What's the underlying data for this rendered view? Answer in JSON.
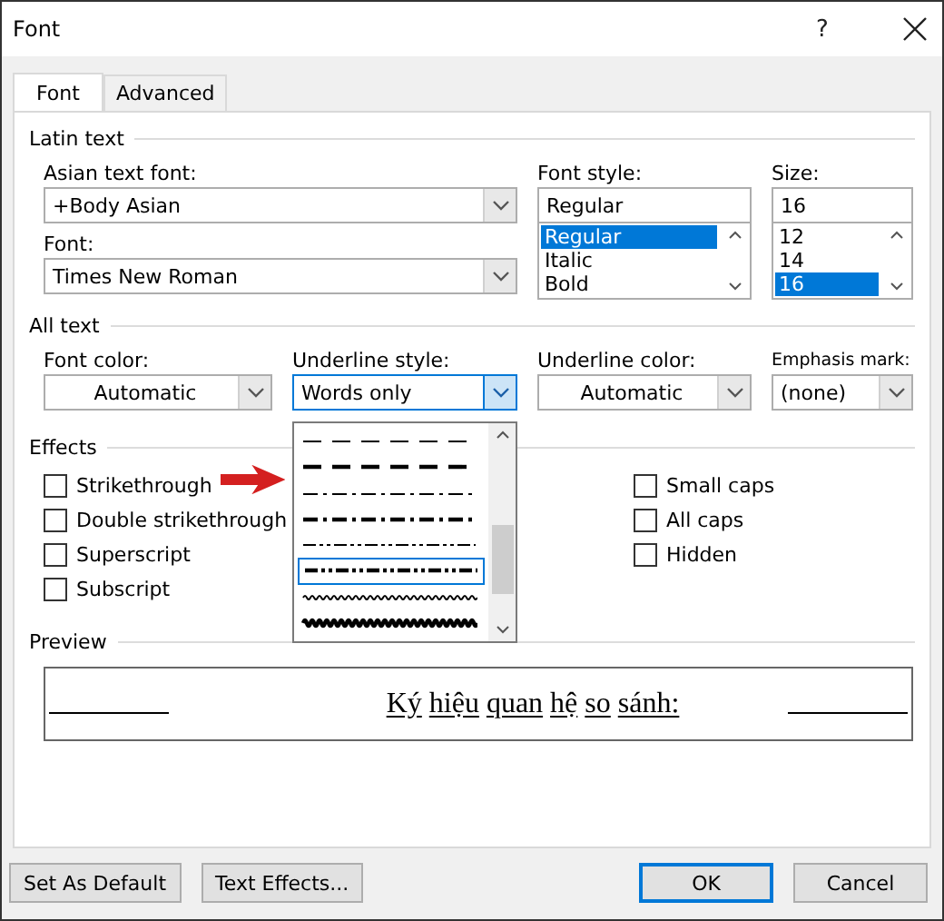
{
  "window": {
    "title": "Font",
    "help": "?"
  },
  "tabs": [
    {
      "label": "Font",
      "selected": true
    },
    {
      "label": "Advanced",
      "selected": false
    }
  ],
  "latin_text": {
    "heading": "Latin text",
    "asian_font": {
      "label": "Asian text font:",
      "value": "+Body Asian"
    },
    "font": {
      "label": "Font:",
      "value": "Times New Roman"
    },
    "font_style": {
      "label": "Font style:",
      "value": "Regular",
      "options": [
        {
          "label": "Regular",
          "selected": true
        },
        {
          "label": "Italic",
          "selected": false
        },
        {
          "label": "Bold",
          "selected": false
        }
      ]
    },
    "size": {
      "label": "Size:",
      "value": "16",
      "options": [
        {
          "label": "12",
          "selected": false
        },
        {
          "label": "14",
          "selected": false
        },
        {
          "label": "16",
          "selected": true
        }
      ]
    }
  },
  "all_text": {
    "heading": "All text",
    "font_color": {
      "label": "Font color:",
      "value": "Automatic"
    },
    "underline_style": {
      "label": "Underline style:",
      "value": "Words only",
      "expanded": true,
      "options": [
        {
          "kind": "dash",
          "selected": false
        },
        {
          "kind": "dash-heavy",
          "selected": false
        },
        {
          "kind": "dash-dot",
          "selected": false
        },
        {
          "kind": "dash-dot-heavy",
          "selected": false
        },
        {
          "kind": "dash-dot-dot",
          "selected": false
        },
        {
          "kind": "dash-dot-dot-heavy",
          "selected": true
        },
        {
          "kind": "wave",
          "selected": false
        },
        {
          "kind": "wave-heavy",
          "selected": false
        }
      ]
    },
    "underline_color": {
      "label": "Underline color:",
      "value": "Automatic"
    },
    "emphasis_mark": {
      "label": "Emphasis mark:",
      "value": "(none)"
    }
  },
  "effects": {
    "heading": "Effects",
    "left": [
      {
        "label": "Strikethrough",
        "checked": false
      },
      {
        "label": "Double strikethrough",
        "checked": false
      },
      {
        "label": "Superscript",
        "checked": false
      },
      {
        "label": "Subscript",
        "checked": false
      }
    ],
    "right": [
      {
        "label": "Small caps",
        "checked": false
      },
      {
        "label": "All caps",
        "checked": false
      },
      {
        "label": "Hidden",
        "checked": false
      }
    ]
  },
  "preview": {
    "heading": "Preview",
    "text": "Ký hiệu quan hệ so sánh:"
  },
  "buttons": [
    {
      "label": "Set As Default",
      "default": false
    },
    {
      "label": "Text Effects...",
      "default": false
    },
    {
      "label": "OK",
      "default": true
    },
    {
      "label": "Cancel",
      "default": false
    }
  ]
}
